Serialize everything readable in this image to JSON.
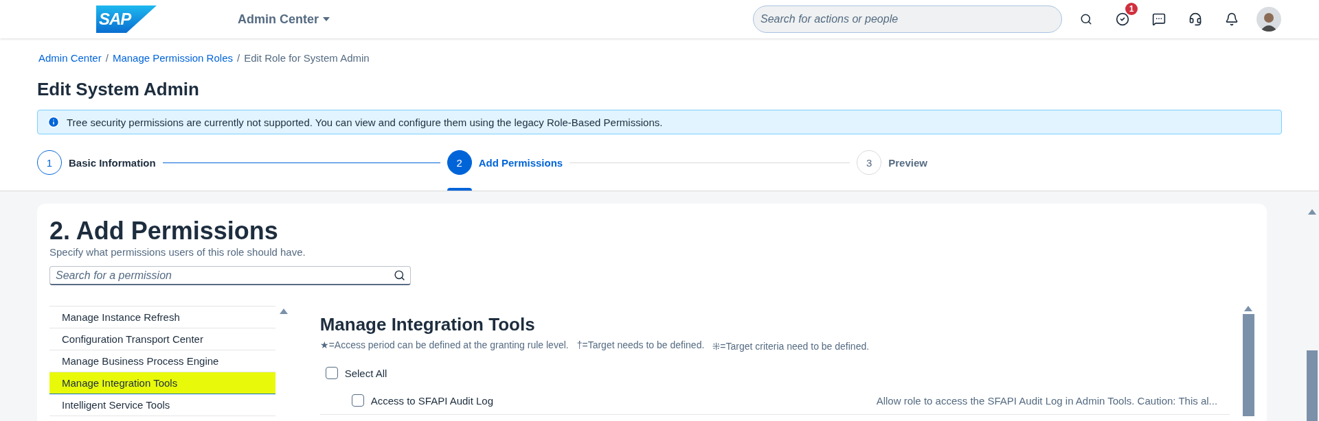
{
  "header": {
    "logo": "SAP",
    "app_menu": "Admin Center",
    "search": {
      "placeholder": "Search for actions or people"
    },
    "notification_count": "1"
  },
  "breadcrumb": [
    {
      "label": "Admin Center",
      "link": true,
      "separator": "/"
    },
    {
      "label": "Manage Permission Roles",
      "link": true,
      "separator": "/"
    },
    {
      "label": "Edit Role for System Admin",
      "link": false
    }
  ],
  "page_title": "Edit System Admin",
  "info_message": "Tree security permissions are currently not supported. You can view and configure them using the legacy Role-Based Permissions.",
  "steps": [
    {
      "number": "1",
      "label": "Basic Information",
      "completed": true,
      "selected": false
    },
    {
      "number": "2",
      "label": "Add Permissions",
      "completed": false,
      "selected": true
    },
    {
      "number": "3",
      "label": "Preview",
      "completed": false,
      "selected": false
    }
  ],
  "section": {
    "title": "2. Add Permissions",
    "subtitle": "Specify what permissions users of this role should have.",
    "search": {
      "placeholder": "Search for a permission"
    }
  },
  "categories": [
    {
      "label": "Manage Instance Refresh",
      "selected": false
    },
    {
      "label": "Configuration Transport Center",
      "selected": false
    },
    {
      "label": "Manage Business Process Engine",
      "selected": false
    },
    {
      "label": "Manage Integration Tools",
      "selected": true
    },
    {
      "label": "Intelligent Service Tools",
      "selected": false
    }
  ],
  "detail": {
    "title": "Manage Integration Tools",
    "legend": [
      {
        "symbol": "★",
        "text": "=Access period can be defined at the granting rule level."
      },
      {
        "symbol": "†",
        "text": "=Target needs to be defined."
      },
      {
        "symbol": "⁜",
        "text": "=Target criteria need to be defined."
      }
    ],
    "select_all": {
      "label": "Select All",
      "checked": false
    },
    "permissions": [
      {
        "label": "Access to SFAPI Audit Log",
        "checked": false,
        "description": "Allow role to access the SFAPI Audit Log in Admin Tools. Caution: This al..."
      }
    ]
  }
}
